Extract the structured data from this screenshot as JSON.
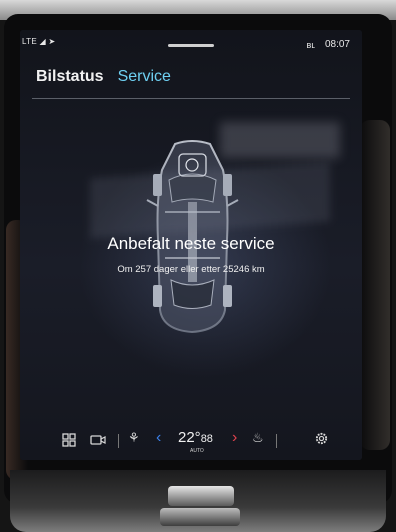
{
  "status_bar": {
    "network": "LTE",
    "bluetooth": "bluetooth-icon",
    "clock": "08:07"
  },
  "tabs": [
    {
      "label": "Bilstatus",
      "active": false
    },
    {
      "label": "Service",
      "active": true
    }
  ],
  "service": {
    "title": "Anbefalt neste service",
    "detail": "Om 257 dager eller etter 25246 km"
  },
  "bottom_bar": {
    "temperature": "22°",
    "temp_mode": "AUTO"
  },
  "colors": {
    "accent": "#6fd0f2",
    "chevron_left": "#3b7fe8",
    "chevron_right": "#e0424e"
  }
}
